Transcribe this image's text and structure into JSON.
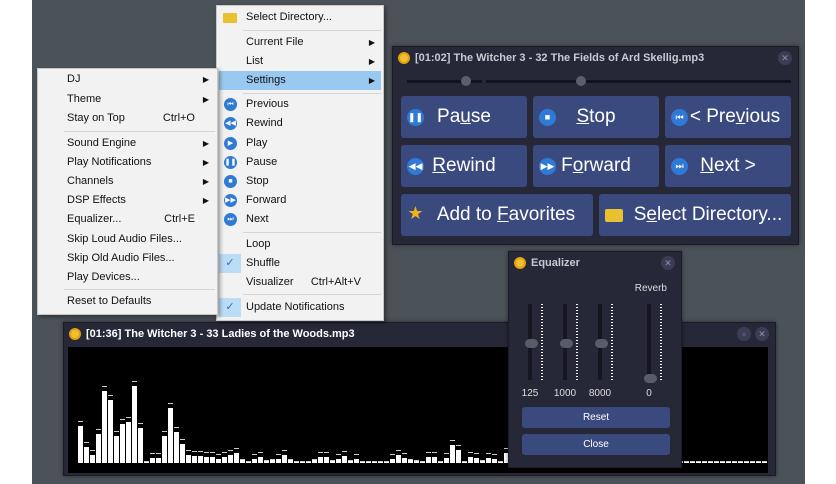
{
  "main_menu": {
    "items": [
      {
        "label": "Select Directory...",
        "icon": "folder-icon"
      },
      {
        "label": "Current File",
        "submenu": true
      },
      {
        "label": "List",
        "submenu": true
      },
      {
        "label": "Settings",
        "submenu": true,
        "highlighted": true
      },
      {
        "label": "Previous",
        "icon": "previous-icon"
      },
      {
        "label": "Rewind",
        "icon": "rewind-icon"
      },
      {
        "label": "Play",
        "icon": "play-icon"
      },
      {
        "label": "Pause",
        "icon": "pause-icon"
      },
      {
        "label": "Stop",
        "icon": "stop-icon"
      },
      {
        "label": "Forward",
        "icon": "forward-icon"
      },
      {
        "label": "Next",
        "icon": "next-icon"
      },
      {
        "label": "Loop"
      },
      {
        "label": "Shuffle",
        "checked": true
      },
      {
        "label": "Visualizer",
        "shortcut": "Ctrl+Alt+V"
      },
      {
        "label": "Update Notifications",
        "checked": true
      }
    ]
  },
  "settings_menu": {
    "items": [
      {
        "label": "DJ",
        "submenu": true
      },
      {
        "label": "Theme",
        "submenu": true
      },
      {
        "label": "Stay on Top",
        "shortcut": "Ctrl+O"
      },
      {
        "label": "Sound Engine",
        "submenu": true
      },
      {
        "label": "Play Notifications",
        "submenu": true
      },
      {
        "label": "Channels",
        "submenu": true
      },
      {
        "label": "DSP Effects",
        "submenu": true
      },
      {
        "label": "Equalizer...",
        "shortcut": "Ctrl+E"
      },
      {
        "label": "Skip Loud Audio Files..."
      },
      {
        "label": "Skip Old Audio Files..."
      },
      {
        "label": "Play Devices..."
      },
      {
        "label": "Reset to Defaults"
      }
    ]
  },
  "player": {
    "title": "[01:02] The Witcher 3 - 32 The Fields of Ard Skellig.mp3",
    "volume": 0.85,
    "position": 0.33,
    "buttons": {
      "pause": [
        "Pa",
        "u",
        "se"
      ],
      "stop": [
        "",
        "S",
        "top"
      ],
      "previous": [
        "< Pre",
        "v",
        "ious"
      ],
      "rewind": [
        "",
        "R",
        "ewind"
      ],
      "forward": [
        "F",
        "o",
        "rward"
      ],
      "next": [
        "",
        "N",
        "ext >"
      ],
      "favorites": [
        "Add to ",
        "F",
        "avorites"
      ],
      "select_dir": [
        "S",
        "e",
        "lect Directory..."
      ]
    }
  },
  "equalizer": {
    "title": "Equalizer",
    "reverb_label": "Reverb",
    "bands": [
      {
        "label": "125",
        "level": 0.5
      },
      {
        "label": "1000",
        "level": 0.5
      },
      {
        "label": "8000",
        "level": 0.5
      },
      {
        "label": "0",
        "level": 0.0
      }
    ],
    "reset": "Reset",
    "close": "Close"
  },
  "visualizer": {
    "title": "[01:36] The Witcher 3 - 33 Ladies of the Woods.mp3",
    "levels": [
      37,
      16,
      8,
      29,
      72,
      63,
      27,
      39,
      41,
      77,
      35,
      1,
      5,
      5,
      27,
      55,
      31,
      19,
      8,
      7,
      7,
      6,
      6,
      4,
      6,
      8,
      10,
      3,
      1,
      4,
      6,
      2,
      3,
      4,
      8,
      3,
      1,
      1,
      1,
      3,
      6,
      6,
      2,
      4,
      7,
      2,
      4,
      1,
      1,
      1,
      1,
      1,
      4,
      8,
      5,
      3,
      2,
      1,
      6,
      6,
      1,
      5,
      18,
      13,
      1,
      6,
      5,
      2,
      5,
      4,
      1,
      10,
      3,
      1,
      1,
      1,
      1,
      1,
      1,
      1,
      1,
      1,
      1,
      1,
      1,
      1,
      1,
      1,
      1,
      1,
      1,
      1,
      1,
      1,
      1,
      1,
      1,
      1,
      1,
      1,
      1,
      1,
      1,
      1,
      1,
      1,
      1,
      1,
      1,
      1,
      1,
      1,
      1,
      1,
      1
    ]
  }
}
